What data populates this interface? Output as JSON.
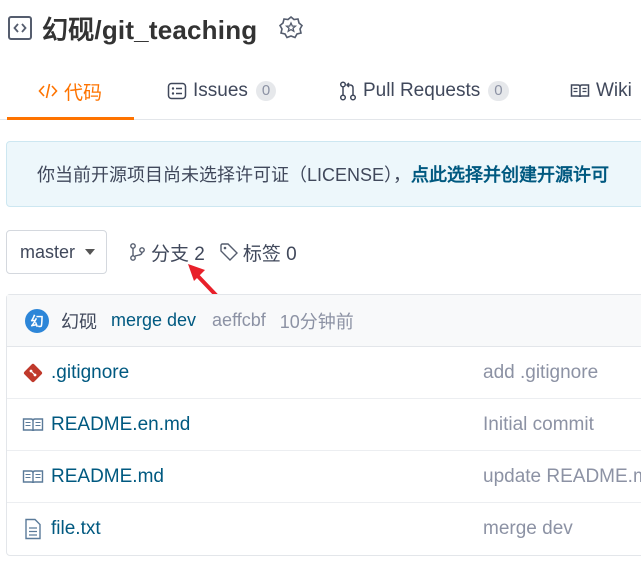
{
  "repo": {
    "title": "幻砚/git_teaching"
  },
  "tabs": [
    {
      "label": "代码",
      "count": null
    },
    {
      "label": "Issues",
      "count": "0"
    },
    {
      "label": "Pull Requests",
      "count": "0"
    },
    {
      "label": "Wiki",
      "count": null
    }
  ],
  "notice": {
    "text": "你当前开源项目尚未选择许可证（LICENSE），",
    "link": "点此选择并创建开源许可"
  },
  "branch": {
    "selected": "master",
    "branches_label": "分支 2",
    "tags_label": "标签 0"
  },
  "last_commit": {
    "avatar_letter": "幻",
    "author": "幻砚",
    "message": "merge dev",
    "sha": "aeffcbf",
    "time": "10分钟前"
  },
  "files": [
    {
      "name": ".gitignore",
      "commit": "add .gitignore",
      "icon": "git-diamond-icon"
    },
    {
      "name": "README.en.md",
      "commit": "Initial commit",
      "icon": "book-icon"
    },
    {
      "name": "README.md",
      "commit": "update README.md",
      "icon": "book-icon"
    },
    {
      "name": "file.txt",
      "commit": "merge dev",
      "icon": "file-text-icon"
    }
  ],
  "colors": {
    "accent": "#fe7300",
    "link": "#005980",
    "notice_bg": "#edf7fb",
    "arrow": "#e8202a"
  }
}
